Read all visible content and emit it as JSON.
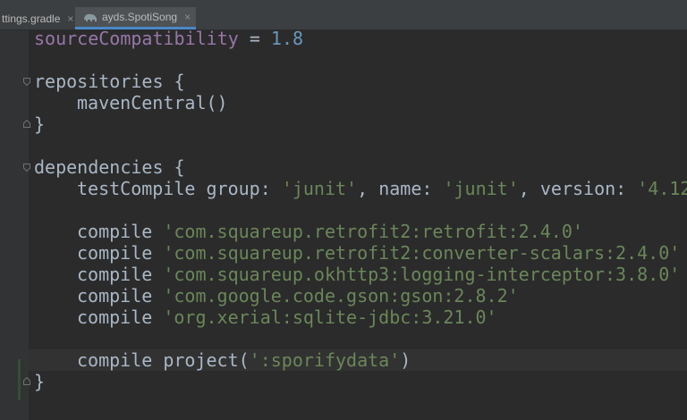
{
  "tabs": [
    {
      "label": "ttings.gradle",
      "close": "×"
    },
    {
      "label": "ayds.SpotiSong",
      "close": "×",
      "icon": "gradle-elephant-icon"
    }
  ],
  "code": {
    "line1": {
      "prop": "sourceCompatibility",
      "op": " = ",
      "num": "1.8"
    },
    "line3": "repositories {",
    "line4": "mavenCentral()",
    "line5": "}",
    "line7": "dependencies {",
    "line8": {
      "cmd": "testCompile ",
      "k1": "group",
      "c1": ": ",
      "v1": "'junit'",
      "s1": ", ",
      "k2": "name",
      "c2": ": ",
      "v2": "'junit'",
      "s2": ", ",
      "k3": "version",
      "c3": ": ",
      "v3": "'4.12"
    },
    "deps": [
      {
        "cmd": "compile ",
        "value": "'com.squareup.retrofit2:retrofit:2.4.0'"
      },
      {
        "cmd": "compile ",
        "value": "'com.squareup.retrofit2:converter-scalars:2.4.0'"
      },
      {
        "cmd": "compile ",
        "value": "'com.squareup.okhttp3:logging-interceptor:3.8.0'"
      },
      {
        "cmd": "compile ",
        "value": "'com.google.code.gson:gson:2.8.2'"
      },
      {
        "cmd": "compile ",
        "value": "'org.xerial:sqlite-jdbc:3.21.0'"
      }
    ],
    "project_line": {
      "cmd": "compile ",
      "fn": "project(",
      "value": "':sporifydata'",
      "close": ")"
    },
    "last_brace": "}"
  },
  "colors": {
    "string": "#6a8759",
    "number": "#6897bb",
    "property": "#9876aa",
    "text": "#a9b7c6"
  }
}
